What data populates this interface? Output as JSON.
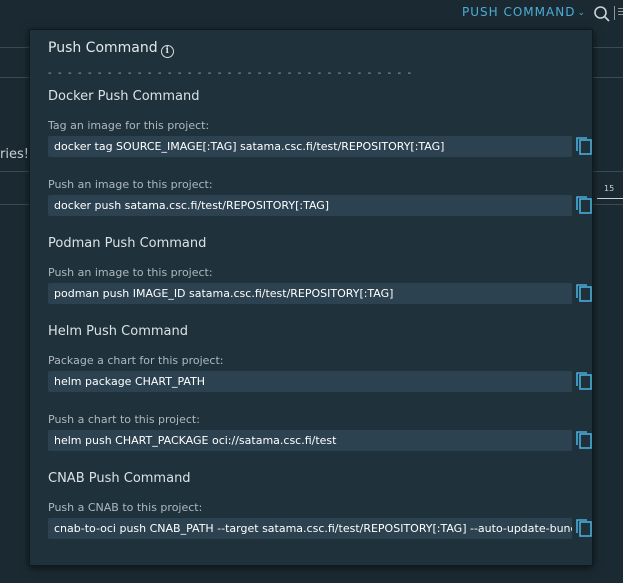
{
  "header": {
    "push_command_label": "PUSH COMMAND",
    "chevron_glyph": "⌄",
    "search_icon": "search-icon"
  },
  "background": {
    "partial_text_left": "ries!",
    "partial_text_right": "15"
  },
  "panel": {
    "title": "Push Command",
    "info_glyph": "i",
    "divider": "- - - - - - - - - - - - - - - - - - - - - - - - - - - - - - - - - - - - -",
    "sections": [
      {
        "title": "Docker Push Command",
        "commands": [
          {
            "label": "Tag an image for this project:",
            "value": "docker tag SOURCE_IMAGE[:TAG] satama.csc.fi/test/REPOSITORY[:TAG]"
          },
          {
            "label": "Push an image to this project:",
            "value": "docker push satama.csc.fi/test/REPOSITORY[:TAG]"
          }
        ]
      },
      {
        "title": "Podman Push Command",
        "commands": [
          {
            "label": "Push an image to this project:",
            "value": "podman push IMAGE_ID satama.csc.fi/test/REPOSITORY[:TAG]"
          }
        ]
      },
      {
        "title": "Helm Push Command",
        "commands": [
          {
            "label": "Package a chart for this project:",
            "value": "helm package CHART_PATH"
          },
          {
            "label": "Push a chart to this project:",
            "value": "helm push CHART_PACKAGE oci://satama.csc.fi/test"
          }
        ]
      },
      {
        "title": "CNAB Push Command",
        "commands": [
          {
            "label": "Push a CNAB to this project:",
            "value": "cnab-to-oci push CNAB_PATH --target satama.csc.fi/test/REPOSITORY[:TAG] --auto-update-bundle"
          }
        ]
      }
    ]
  },
  "colors": {
    "accent": "#4aaed9",
    "page_bg": "#1b2a32",
    "panel_bg": "#1f313b",
    "command_bg": "#2d4250"
  }
}
